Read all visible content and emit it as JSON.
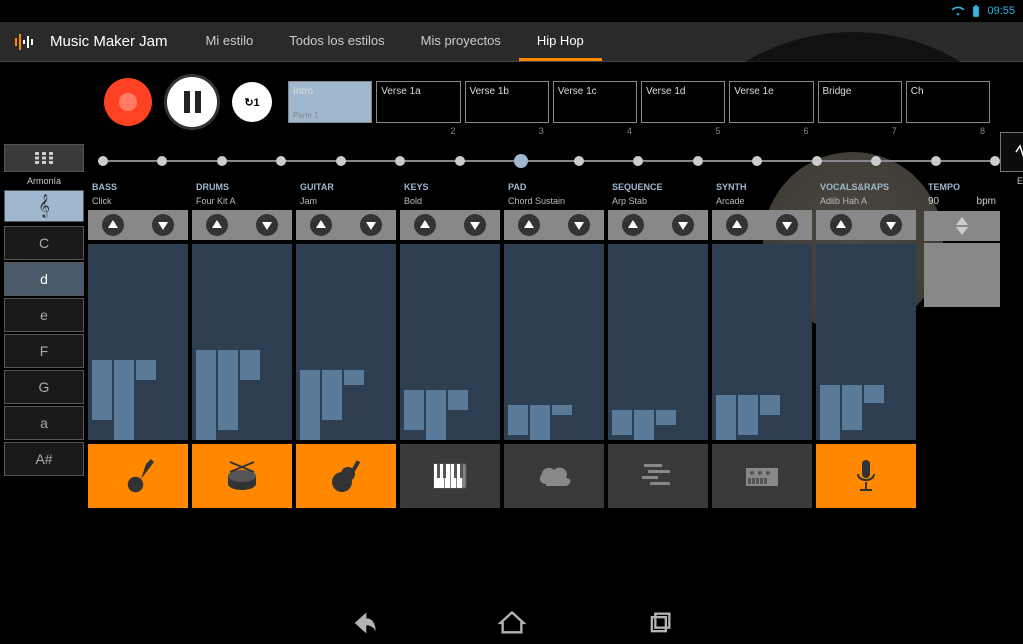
{
  "status": {
    "time": "09:55"
  },
  "app": {
    "title": "Music Maker Jam"
  },
  "nav": {
    "tabs": [
      {
        "label": "Mi estilo",
        "active": false
      },
      {
        "label": "Todos los estilos",
        "active": false
      },
      {
        "label": "Mis proyectos",
        "active": false
      },
      {
        "label": "Hip Hop",
        "active": true
      }
    ]
  },
  "parts": [
    {
      "label": "Intro",
      "sublabel": "Parte 1",
      "number": "",
      "active": true
    },
    {
      "label": "Verse 1a",
      "sublabel": "",
      "number": "2",
      "active": false
    },
    {
      "label": "Verse 1b",
      "sublabel": "",
      "number": "3",
      "active": false
    },
    {
      "label": "Verse 1c",
      "sublabel": "",
      "number": "4",
      "active": false
    },
    {
      "label": "Verse 1d",
      "sublabel": "",
      "number": "5",
      "active": false
    },
    {
      "label": "Verse 1e",
      "sublabel": "",
      "number": "6",
      "active": false
    },
    {
      "label": "Bridge",
      "sublabel": "",
      "number": "7",
      "active": false
    },
    {
      "label": "Ch",
      "sublabel": "",
      "number": "8",
      "active": false
    }
  ],
  "harmony": {
    "label": "Armonía"
  },
  "keys": [
    {
      "label": "C",
      "active": false
    },
    {
      "label": "d",
      "active": true
    },
    {
      "label": "e",
      "active": false
    },
    {
      "label": "F",
      "active": false
    },
    {
      "label": "G",
      "active": false
    },
    {
      "label": "a",
      "active": false
    },
    {
      "label": "A#",
      "active": false
    }
  ],
  "effects": {
    "label": "Efectos"
  },
  "tracks": [
    {
      "name": "BASS",
      "preset": "Click",
      "icon": "guitar-electric",
      "color": "orange",
      "bars": [
        60,
        80,
        20
      ]
    },
    {
      "name": "DRUMS",
      "preset": "Four Kit A",
      "icon": "drums",
      "color": "orange",
      "bars": [
        90,
        80,
        30
      ]
    },
    {
      "name": "GUITAR",
      "preset": "Jam",
      "icon": "guitar-acoustic",
      "color": "orange",
      "bars": [
        70,
        50,
        15
      ]
    },
    {
      "name": "KEYS",
      "preset": "Bold",
      "icon": "piano",
      "color": "gray",
      "bars": [
        40,
        50,
        20
      ]
    },
    {
      "name": "PAD",
      "preset": "Chord Sustain",
      "icon": "cloud",
      "color": "gray",
      "bars": [
        30,
        35,
        10
      ]
    },
    {
      "name": "SEQUENCE",
      "preset": "Arp Stab",
      "icon": "sequence",
      "color": "gray",
      "bars": [
        25,
        30,
        15
      ]
    },
    {
      "name": "SYNTH",
      "preset": "Arcade",
      "icon": "synth",
      "color": "gray",
      "bars": [
        45,
        40,
        20
      ]
    },
    {
      "name": "VOCALS&RAPS",
      "preset": "Adlib Hah A",
      "icon": "mic",
      "color": "orange",
      "bars": [
        55,
        45,
        18
      ]
    }
  ],
  "tempo": {
    "label": "TEMPO",
    "value": "90",
    "unit": "bpm"
  },
  "timeline": {
    "dots": 16,
    "active": 7
  }
}
